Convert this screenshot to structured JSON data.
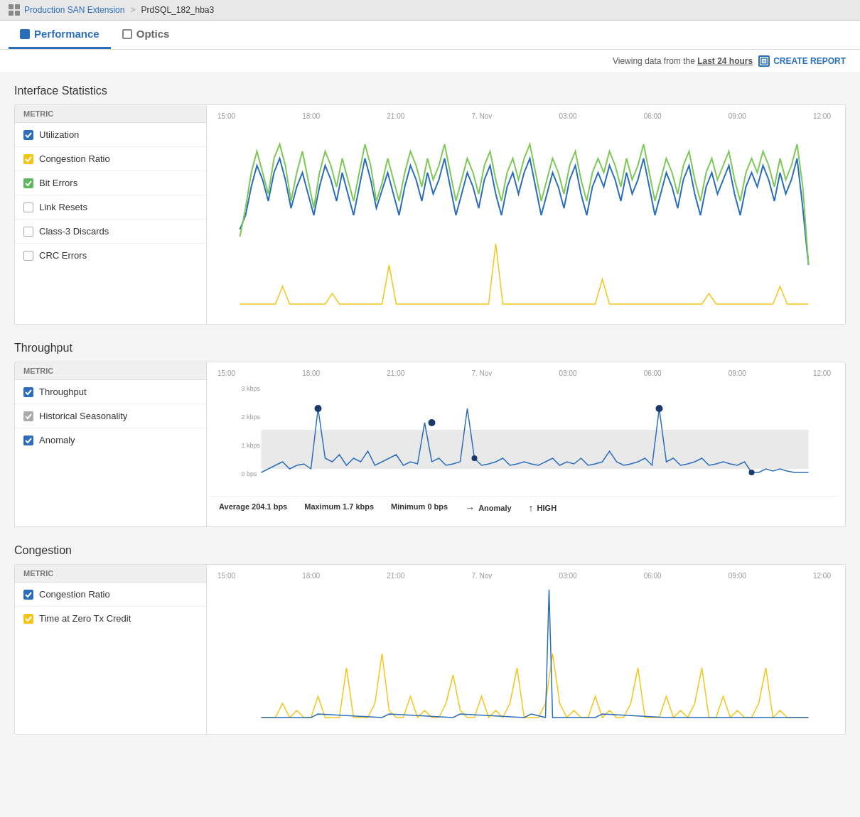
{
  "breadcrumb": {
    "icon": "grid-icon",
    "parent": "Production SAN Extension",
    "separator": ">",
    "current": "PrdSQL_182_hba3"
  },
  "tabs": [
    {
      "id": "performance",
      "label": "Performance",
      "active": true
    },
    {
      "id": "optics",
      "label": "Optics",
      "active": false
    }
  ],
  "header": {
    "viewing_label": "Viewing data from the",
    "time_range": "Last 24 hours",
    "create_report_label": "CREATE REPORT"
  },
  "sections": {
    "interface_statistics": {
      "title": "Interface Statistics",
      "metric_header": "Metric",
      "metrics": [
        {
          "id": "utilization",
          "label": "Utilization",
          "checked": true,
          "color": "blue"
        },
        {
          "id": "congestion_ratio",
          "label": "Congestion Ratio",
          "checked": true,
          "color": "yellow"
        },
        {
          "id": "bit_errors",
          "label": "Bit Errors",
          "checked": true,
          "color": "green"
        },
        {
          "id": "link_resets",
          "label": "Link Resets",
          "checked": false,
          "color": "none"
        },
        {
          "id": "class3_discards",
          "label": "Class-3 Discards",
          "checked": false,
          "color": "none"
        },
        {
          "id": "crc_errors",
          "label": "CRC Errors",
          "checked": false,
          "color": "none"
        }
      ],
      "time_labels": [
        "15:00",
        "18:00",
        "21:00",
        "7. Nov",
        "03:00",
        "06:00",
        "09:00",
        "12:00"
      ]
    },
    "throughput": {
      "title": "Throughput",
      "metric_header": "Metric",
      "metrics": [
        {
          "id": "throughput",
          "label": "Throughput",
          "checked": true,
          "color": "blue"
        },
        {
          "id": "historical_seasonality",
          "label": "Historical Seasonality",
          "checked": true,
          "color": "gray"
        },
        {
          "id": "anomaly",
          "label": "Anomaly",
          "checked": true,
          "color": "blue"
        }
      ],
      "time_labels": [
        "15:00",
        "18:00",
        "21:00",
        "7. Nov",
        "03:00",
        "06:00",
        "09:00",
        "12:00"
      ],
      "y_labels": [
        "3 kbps",
        "2 kbps",
        "1 kbps",
        "0 bps"
      ],
      "stats": {
        "average_label": "Average",
        "average_value": "204.1 bps",
        "maximum_label": "Maximum",
        "maximum_value": "1.7 kbps",
        "minimum_label": "Minimum",
        "minimum_value": "0 bps",
        "anomaly_label": "Anomaly",
        "high_label": "HIGH"
      }
    },
    "congestion": {
      "title": "Congestion",
      "metric_header": "Metric",
      "metrics": [
        {
          "id": "congestion_ratio",
          "label": "Congestion Ratio",
          "checked": true,
          "color": "blue"
        },
        {
          "id": "time_zero_tx",
          "label": "Time at Zero Tx Credit",
          "checked": true,
          "color": "yellow"
        }
      ],
      "time_labels": [
        "15:00",
        "18:00",
        "21:00",
        "7. Nov",
        "03:00",
        "06:00",
        "09:00",
        "12:00"
      ]
    }
  }
}
